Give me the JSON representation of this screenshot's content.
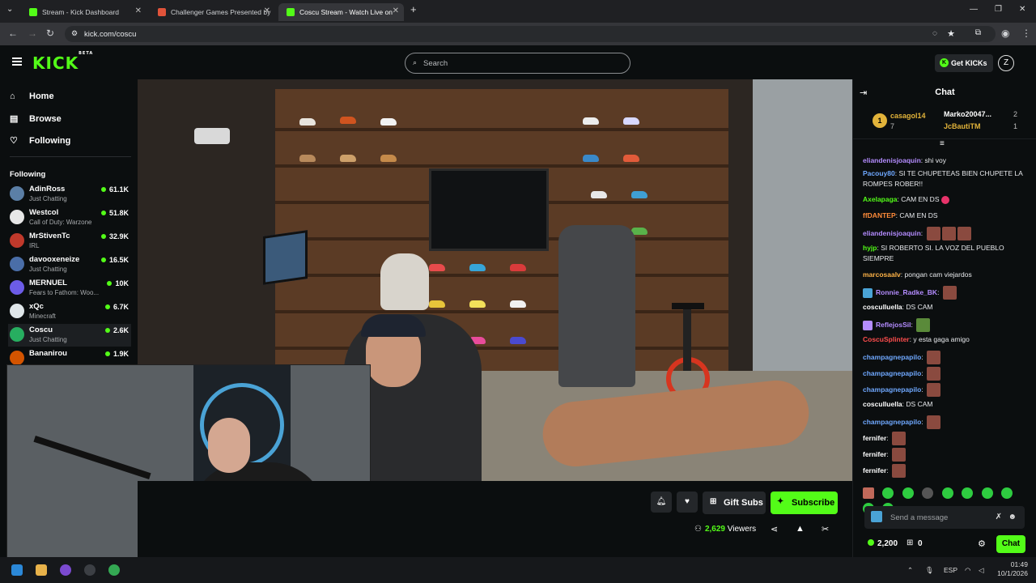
{
  "browser": {
    "tabs": [
      {
        "title": "Stream - Kick Dashboard",
        "color": "#53fc18"
      },
      {
        "title": "Challenger Games Presented by",
        "color": "#e0533a"
      },
      {
        "title": "Coscu Stream - Watch Live on",
        "color": "#53fc18"
      }
    ],
    "url": "kick.com/coscu"
  },
  "header": {
    "logo": "KICK",
    "logo_badge": "BETA",
    "search_placeholder": "Search",
    "get_kicks_label": "Get KICKs"
  },
  "sidebar": {
    "nav": [
      {
        "label": "Home",
        "icon": "home-icon"
      },
      {
        "label": "Browse",
        "icon": "browse-icon"
      },
      {
        "label": "Following",
        "icon": "heart-icon"
      }
    ],
    "following_title": "Following",
    "channels": [
      {
        "name": "AdinRoss",
        "category": "Just Chatting",
        "viewers": "61.1K",
        "avatar": "#5b7fa6"
      },
      {
        "name": "Westcol",
        "category": "Call of Duty: Warzone",
        "viewers": "51.8K",
        "avatar": "#e7e7e7"
      },
      {
        "name": "MrStivenTc",
        "category": "IRL",
        "viewers": "32.9K",
        "avatar": "#c0392b"
      },
      {
        "name": "davooxeneize",
        "category": "Just Chatting",
        "viewers": "16.5K",
        "avatar": "#4a6ea8"
      },
      {
        "name": "MERNUEL",
        "category": "Fears to Fathom: Woo...",
        "viewers": "10K",
        "avatar": "#6c5ce7"
      },
      {
        "name": "xQc",
        "category": "Minecraft",
        "viewers": "6.7K",
        "avatar": "#dfe6e9"
      },
      {
        "name": "Coscu",
        "category": "Just Chatting",
        "viewers": "2.6K",
        "avatar": "#27ae60"
      },
      {
        "name": "Bananirou",
        "category": "",
        "viewers": "1.9K",
        "avatar": "#d35400"
      }
    ]
  },
  "stream": {
    "gift_label": "Gift Subs",
    "subscribe_label": "Subscribe",
    "viewers_count": "2,629",
    "viewers_label": "Viewers"
  },
  "chat": {
    "title": "Chat",
    "pinned": {
      "rank": "1",
      "top_gifter": "casagol14",
      "top_count": "7",
      "gifters": [
        {
          "name": "Marko20047...",
          "count": "2"
        },
        {
          "name": "JcBautiTM",
          "count": "1"
        }
      ]
    },
    "messages": [
      {
        "user": "eliandenisjoaquin",
        "color": "#b48cff",
        "text": "shi voy"
      },
      {
        "user": "Pacouy80",
        "color": "#6fa8ff",
        "text": "SI TE CHUPETEAS BIEN CHUPETE LA ROMPES ROBER!!"
      },
      {
        "user": "Axelapaga",
        "color": "#53fc18",
        "text": "CAM EN DS"
      },
      {
        "user": "ffDANTEP",
        "color": "#ff8c3a",
        "text": "CAM EN DS"
      },
      {
        "user": "eliandenisjoaquin",
        "color": "#b48cff",
        "text": ""
      },
      {
        "user": "hyjp",
        "color": "#53fc18",
        "text": "SI ROBERTO SI. LA VOZ DEL PUEBLO SIEMPRE"
      },
      {
        "user": "marcosaalv",
        "color": "#ffb347",
        "text": "pongan cam viejardos"
      },
      {
        "user": "Ronnie_Radke_BK",
        "color": "#b48cff",
        "text": ""
      },
      {
        "user": "cosculluella",
        "color": "#ffffff",
        "text": "DS CAM"
      },
      {
        "user": "ReflejosSil",
        "color": "#b48cff",
        "text": ""
      },
      {
        "user": "CoscuSplinter",
        "color": "#ff4d4d",
        "text": "y esta gaga amigo"
      },
      {
        "user": "champagnepapilo",
        "color": "#6fa8ff",
        "text": ""
      },
      {
        "user": "champagnepapilo",
        "color": "#6fa8ff",
        "text": ""
      },
      {
        "user": "champagnepapilo",
        "color": "#6fa8ff",
        "text": ""
      },
      {
        "user": "cosculluella",
        "color": "#ffffff",
        "text": "DS CAM"
      },
      {
        "user": "champagnepapilo",
        "color": "#6fa8ff",
        "text": ""
      },
      {
        "user": "fernifer",
        "color": "#ffffff",
        "text": ""
      },
      {
        "user": "fernifer",
        "color": "#ffffff",
        "text": ""
      },
      {
        "user": "fernifer",
        "color": "#ffffff",
        "text": ""
      }
    ],
    "input_placeholder": "Send a message",
    "kicks_count": "2,200",
    "gift_count": "0",
    "chat_button": "Chat"
  },
  "taskbar": {
    "lang": "ESP",
    "time": "01:49",
    "date": "10/1/2026"
  },
  "colors": {
    "accent": "#53fc18",
    "background": "#0b0e0f",
    "panel": "#24272a"
  }
}
